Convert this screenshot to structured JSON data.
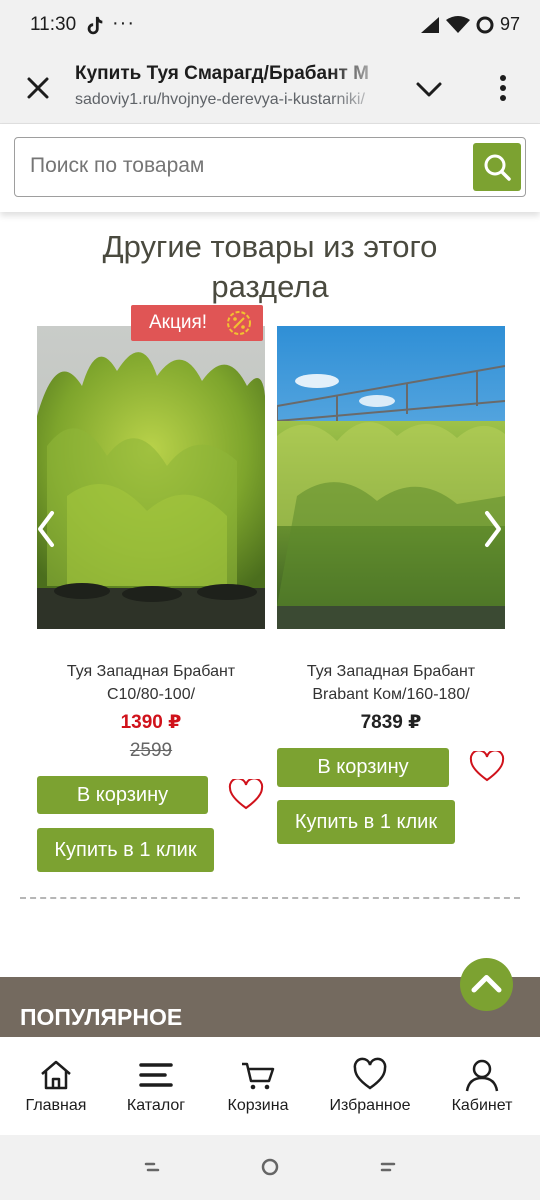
{
  "status_bar": {
    "time": "11:30",
    "battery": "97"
  },
  "browser": {
    "title": "Купить Туя Смарагд/Брабант М",
    "url": "sadoviy1.ru/hvojnye-derevya-i-kustarniki/"
  },
  "search": {
    "placeholder": "Поиск по товарам"
  },
  "section": {
    "heading": "Другие товары из этого раздела"
  },
  "products": [
    {
      "name": "Туя Западная Брабант С10/80-100/",
      "price": "1390 ₽",
      "old_price": "2599",
      "badge": "Акция!",
      "cart_label": "В корзину",
      "buy_label": "Купить в 1 клик",
      "price_color": "#d0121b"
    },
    {
      "name": "Туя Западная Брабант Brabant Ком/160-180/",
      "price": "7839 ₽",
      "cart_label": "В корзину",
      "buy_label": "Купить в 1 клик",
      "price_color": "#222222"
    }
  ],
  "popular": {
    "title": "ПОПУЛЯРНОЕ"
  },
  "bottom_nav": [
    {
      "label": "Главная",
      "icon": "home-icon"
    },
    {
      "label": "Каталог",
      "icon": "menu-icon"
    },
    {
      "label": "Корзина",
      "icon": "cart-icon"
    },
    {
      "label": "Избранное",
      "icon": "heart-icon"
    },
    {
      "label": "Кабинет",
      "icon": "user-icon"
    }
  ],
  "colors": {
    "accent": "#7ca231",
    "promo": "#e05555",
    "band": "#746a5f"
  }
}
